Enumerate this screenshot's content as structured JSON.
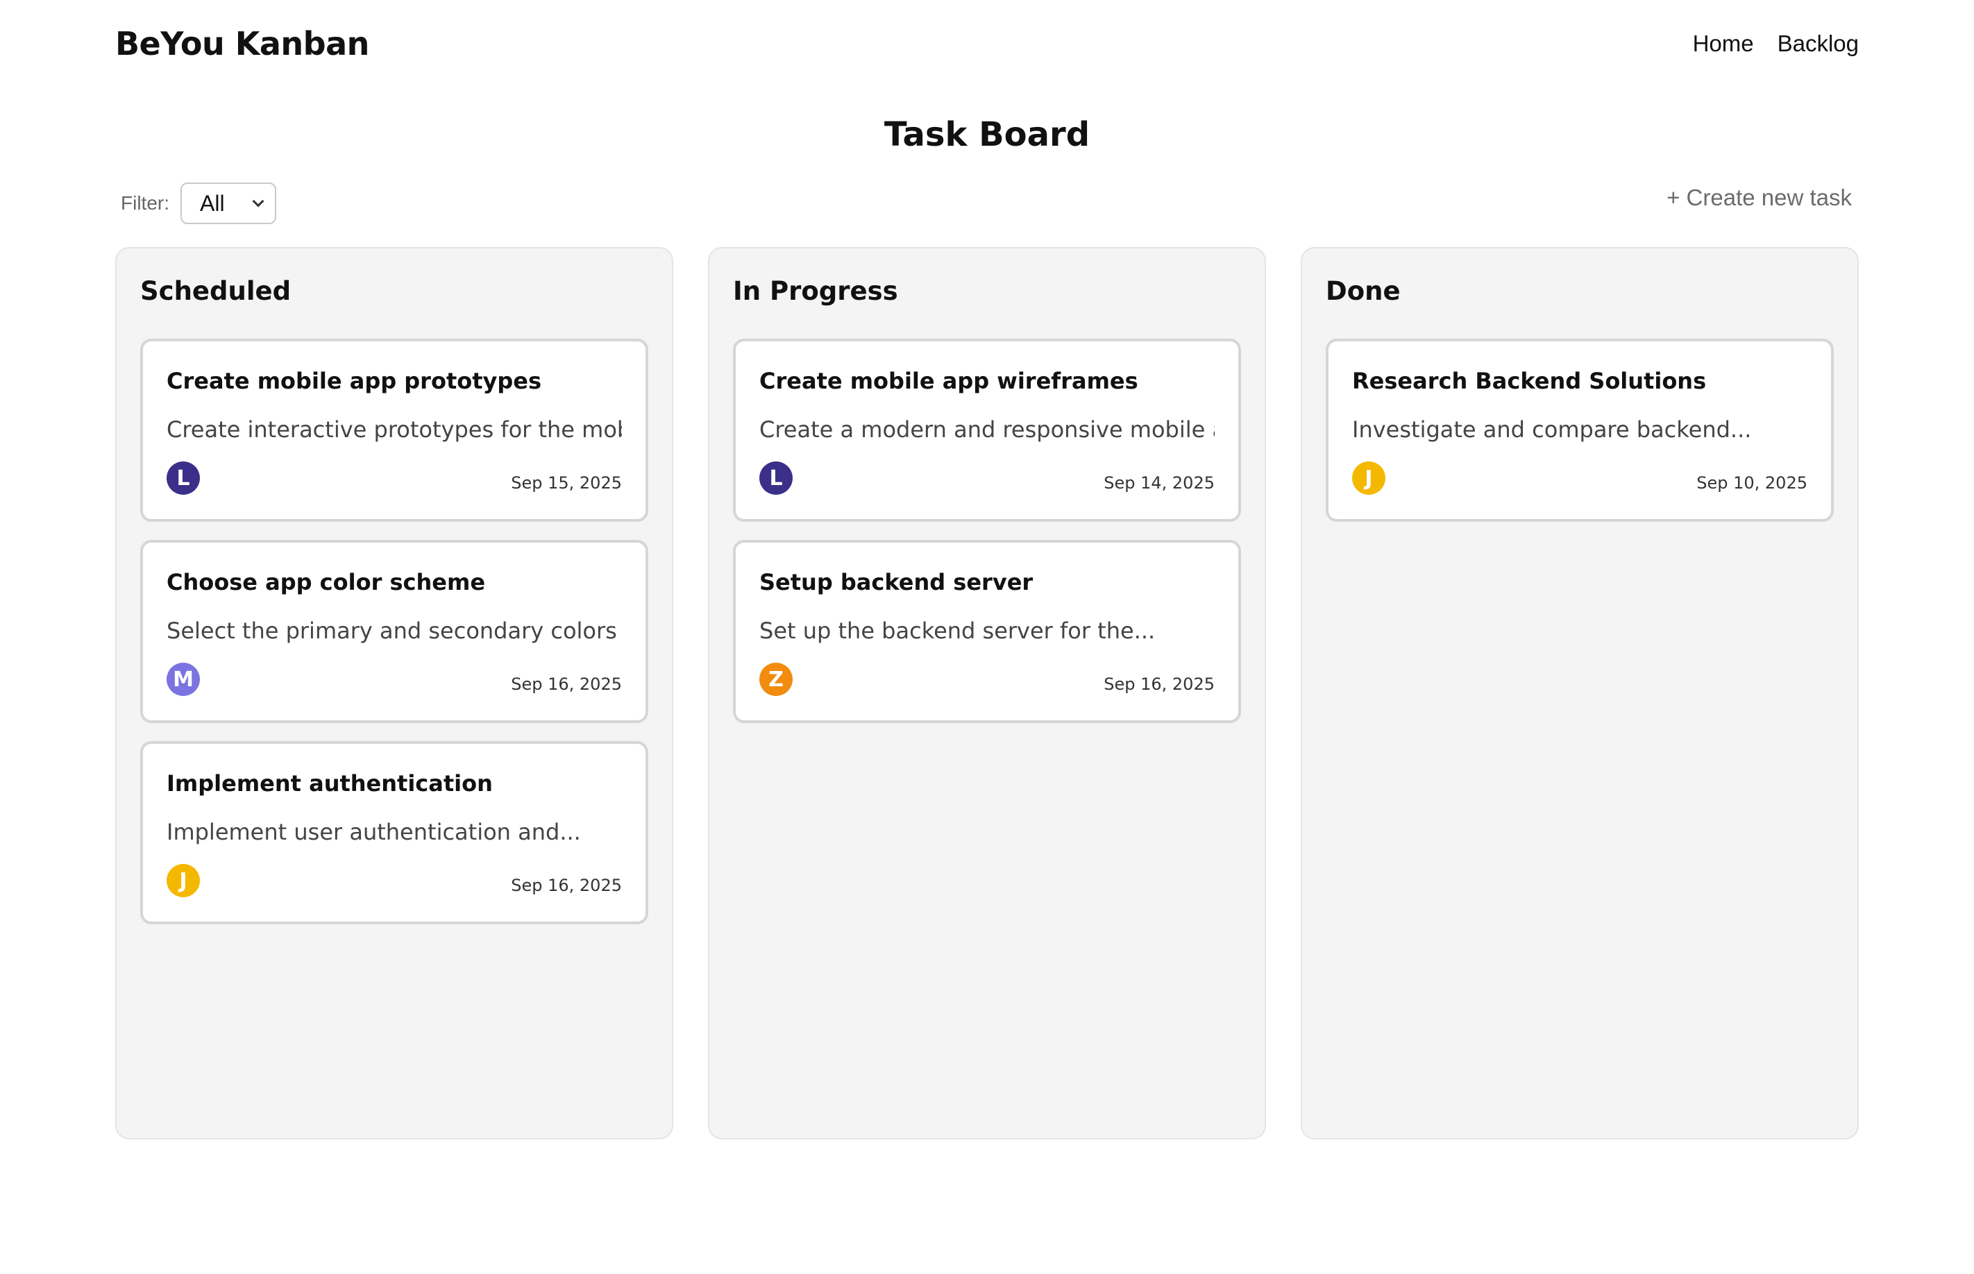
{
  "app": {
    "title": "BeYou Kanban"
  },
  "nav": [
    {
      "label": "Home"
    },
    {
      "label": "Backlog"
    }
  ],
  "page": {
    "title": "Task Board"
  },
  "filter": {
    "label": "Filter:",
    "selected": "All"
  },
  "create_task": {
    "label": "+ Create new task"
  },
  "avatar_colors": {
    "L": "#3b2f8a",
    "M": "#7b74e0",
    "J": "#f5b800",
    "Z": "#f28c0f"
  },
  "columns": [
    {
      "title": "Scheduled",
      "cards": [
        {
          "title": "Create mobile app prototypes",
          "description": "Create interactive prototypes for the mobile...",
          "assignee": "L",
          "date": "Sep 15, 2025"
        },
        {
          "title": "Choose app color scheme",
          "description": "Select the primary and secondary colors for...",
          "assignee": "M",
          "date": "Sep 16, 2025"
        },
        {
          "title": "Implement authentication",
          "description": "Implement user authentication and...",
          "assignee": "J",
          "date": "Sep 16, 2025"
        }
      ]
    },
    {
      "title": "In Progress",
      "cards": [
        {
          "title": "Create mobile app wireframes",
          "description": "Create a modern and responsive mobile app...",
          "assignee": "L",
          "date": "Sep 14, 2025"
        },
        {
          "title": "Setup backend server",
          "description": "Set up the backend server for the...",
          "assignee": "Z",
          "date": "Sep 16, 2025"
        }
      ]
    },
    {
      "title": "Done",
      "cards": [
        {
          "title": "Research Backend Solutions",
          "description": "Investigate and compare backend...",
          "assignee": "J",
          "date": "Sep 10, 2025"
        }
      ]
    }
  ]
}
